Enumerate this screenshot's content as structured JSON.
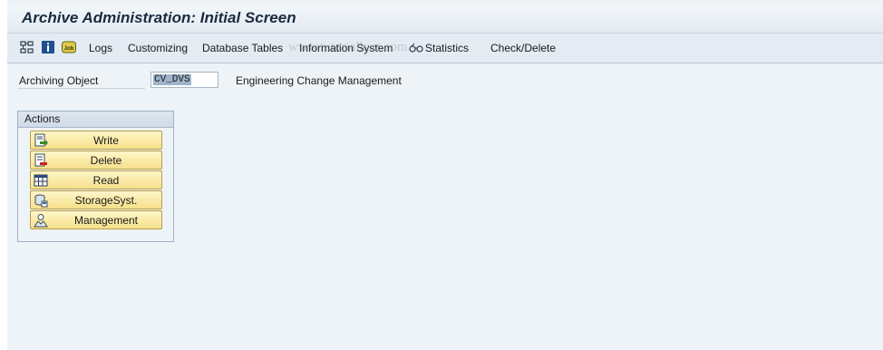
{
  "window": {
    "title": "Archive Administration: Initial Screen"
  },
  "toolbar": {
    "icons": [
      "hierarchy-icon",
      "info-icon",
      "job-icon"
    ],
    "job_icon_text": "Job",
    "items": {
      "logs": "Logs",
      "customizing": "Customizing",
      "database_tables": "Database Tables",
      "information_system": "Information System",
      "statistics": "Statistics",
      "check_delete": "Check/Delete"
    }
  },
  "watermark": "www.tutorialkart.com",
  "form": {
    "archiving_object_label": "Archiving Object",
    "archiving_object_value": "CV_DVS",
    "archiving_object_description": "Engineering Change Management"
  },
  "actions": {
    "title": "Actions",
    "buttons": {
      "write": "Write",
      "delete": "Delete",
      "read": "Read",
      "storage_system": "StorageSyst.",
      "management": "Management"
    }
  },
  "colors": {
    "background": "#eef3f8",
    "button_fill": "#f6e08a",
    "button_border": "#b59d4c",
    "title_text": "#1b2b3f"
  }
}
